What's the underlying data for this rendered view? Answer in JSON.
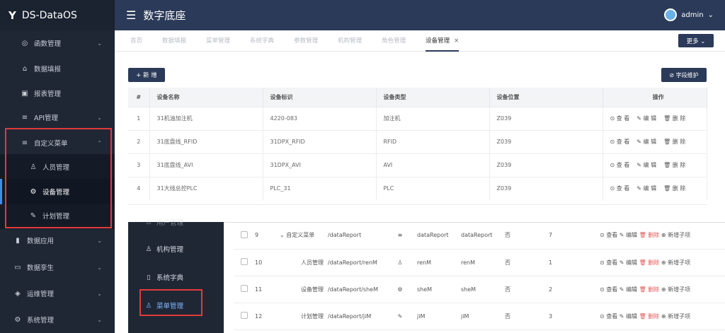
{
  "app": {
    "brand": "DS-DataOS",
    "title": "数字底座",
    "user": "admin"
  },
  "sidebar": {
    "items": [
      {
        "label": "函数管理",
        "icon": "◎"
      },
      {
        "label": "数据填报",
        "icon": "⌂"
      },
      {
        "label": "报表管理",
        "icon": "▣"
      },
      {
        "label": "API管理",
        "icon": "≡"
      },
      {
        "label": "自定义菜单",
        "icon": "≡"
      }
    ],
    "sub": [
      {
        "label": "人员管理",
        "icon": "♙"
      },
      {
        "label": "设备管理",
        "icon": "⚙"
      },
      {
        "label": "计划管理",
        "icon": "✎"
      }
    ],
    "bottom": [
      {
        "label": "数据应用",
        "icon": "▮"
      },
      {
        "label": "数据孪生",
        "icon": "▭"
      },
      {
        "label": "运维管理",
        "icon": "◈"
      },
      {
        "label": "系统管理",
        "icon": "⚙"
      }
    ]
  },
  "tabs": [
    "首页",
    "数据填报",
    "菜单管理",
    "系统字典",
    "参数管理",
    "机构管理",
    "角色管理",
    "设备管理"
  ],
  "more": "更多 ⌄",
  "toolbar": {
    "add": "+ 新 增",
    "field": "⊘ 字段维护"
  },
  "device_table": {
    "headers": [
      "#",
      "设备名称",
      "设备标识",
      "设备类型",
      "设备位置",
      "操作"
    ],
    "rows": [
      [
        "1",
        "31机油加注机",
        "4220-083",
        "加注机",
        "Z039"
      ],
      [
        "2",
        "31底盘线_RFID",
        "31DPX_RFID",
        "RFID",
        "Z039"
      ],
      [
        "3",
        "31底盘线_AVI",
        "31DPX_AVI",
        "AVI",
        "Z039"
      ],
      [
        "4",
        "31大线总控PLC",
        "PLC_31",
        "PLC",
        "Z039"
      ]
    ],
    "ops": [
      "⊙ 查 看",
      "✎ 编 辑",
      "🗑 删 除"
    ]
  },
  "overlay_side": [
    {
      "label": "用户管理",
      "icon": "♙"
    },
    {
      "label": "机构管理",
      "icon": "♙"
    },
    {
      "label": "系统字典",
      "icon": "▯"
    },
    {
      "label": "菜单管理",
      "icon": "♙"
    }
  ],
  "menu_table": {
    "rows": [
      {
        "no": "9",
        "name": "⌄ 自定义菜单",
        "path": "/dataReport",
        "icon": "≡",
        "code": "dataReport",
        "comp": "dataReport",
        "hidden": "否",
        "sort": "7"
      },
      {
        "no": "10",
        "name": "人员管理",
        "path": "/dataReport/renM",
        "icon": "♙",
        "code": "renM",
        "comp": "renM",
        "hidden": "否",
        "sort": "1"
      },
      {
        "no": "11",
        "name": "设备管理",
        "path": "/dataReport/sheM",
        "icon": "⚙",
        "code": "sheM",
        "comp": "sheM",
        "hidden": "否",
        "sort": "2"
      },
      {
        "no": "12",
        "name": "计划管理",
        "path": "/dataReport/jiM",
        "icon": "✎",
        "code": "jiM",
        "comp": "jiM",
        "hidden": "否",
        "sort": "3"
      }
    ],
    "ops": [
      "⊙ 查看",
      "✎ 编辑",
      "🗑 删除",
      "⊕ 新增子项"
    ]
  }
}
